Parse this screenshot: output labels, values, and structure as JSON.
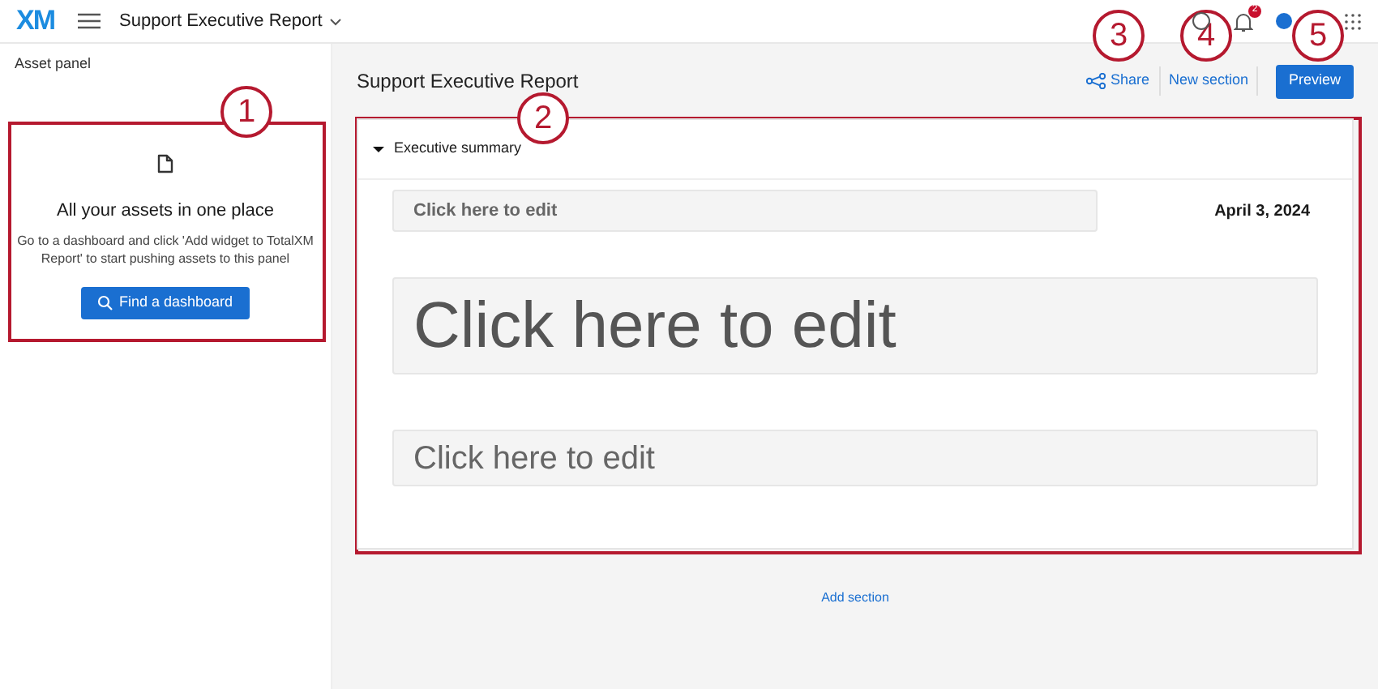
{
  "header": {
    "logo": "XM",
    "report_menu": "Support Executive Report",
    "notification_count": "2"
  },
  "asset_panel": {
    "title": "Asset panel",
    "empty_title": "All your assets in one place",
    "empty_text": "Go to a dashboard and click 'Add widget to TotalXM Report' to start pushing assets to this panel",
    "button": "Find a dashboard"
  },
  "report": {
    "title": "Support Executive Report",
    "share": "Share",
    "new_section": "New section",
    "preview": "Preview",
    "sections": [
      {
        "title": "Executive summary",
        "expanded": true,
        "date": "April 3, 2024",
        "fields": [
          {
            "kind": "subtitle",
            "text": "Click here to edit"
          },
          {
            "kind": "heading",
            "text": "Click here to edit"
          },
          {
            "kind": "body",
            "text": "Click here to edit"
          }
        ]
      }
    ],
    "add_section": "Add section"
  },
  "callouts": [
    {
      "number": "1"
    },
    {
      "number": "2"
    },
    {
      "number": "3"
    },
    {
      "number": "4"
    },
    {
      "number": "5"
    }
  ]
}
